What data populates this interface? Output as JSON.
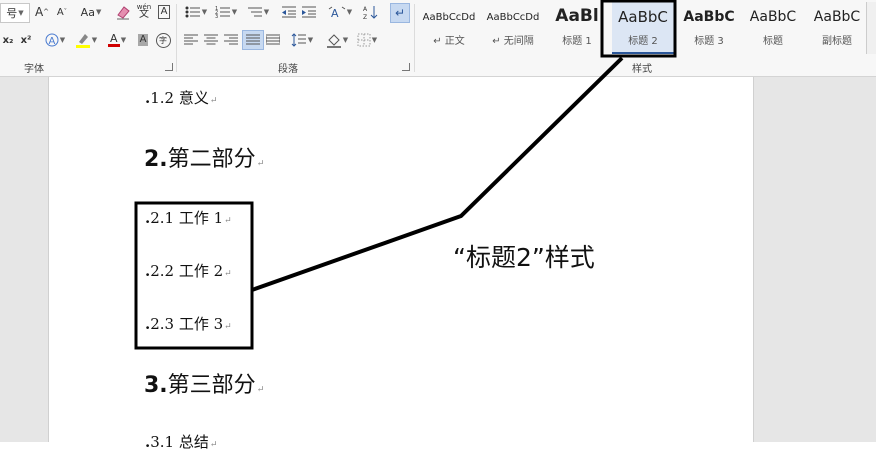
{
  "ribbon": {
    "font_size_fragment": "号",
    "font_group_label": "字体",
    "paragraph_group_label": "段落",
    "styles_group_label": "样式",
    "pinyin_top": "wén",
    "pinyin_bottom": "文",
    "case_label": "Aa",
    "grow_font": "A",
    "shrink_font": "A",
    "border_char": "A",
    "subscript": "x₂",
    "superscript": "x²",
    "shade_char": "A",
    "enclosed_char": "字",
    "font_color_char": "A",
    "accent_blue": "#2b579a",
    "highlight_color": "#ffff00",
    "font_color_red": "#d00000"
  },
  "styles": [
    {
      "sample": "AaBbCcDd",
      "name": "↵ 正文"
    },
    {
      "sample": "AaBbCcDd",
      "name": "↵ 无间隔"
    },
    {
      "sample": "AaBl",
      "name": "标题 1"
    },
    {
      "sample": "AaBbC",
      "name": "标题 2"
    },
    {
      "sample": "AaBbC",
      "name": "标题 3"
    },
    {
      "sample": "AaBbC",
      "name": "标题"
    },
    {
      "sample": "AaBbC",
      "name": "副标题"
    }
  ],
  "document": {
    "items": [
      {
        "text": "1.2 意义",
        "level": "h3"
      },
      {
        "num": "2.",
        "text": "第二部分",
        "level": "h2"
      },
      {
        "text": "2.1 工作 1",
        "level": "h3"
      },
      {
        "text": "2.2 工作 2",
        "level": "h3"
      },
      {
        "text": "2.3 工作 3",
        "level": "h3"
      },
      {
        "num": "3.",
        "text": "第三部分",
        "level": "h2"
      },
      {
        "text": "3.1 总结",
        "level": "h3"
      }
    ],
    "para_mark": "↵"
  },
  "annotation": {
    "label": "“标题2”样式"
  }
}
